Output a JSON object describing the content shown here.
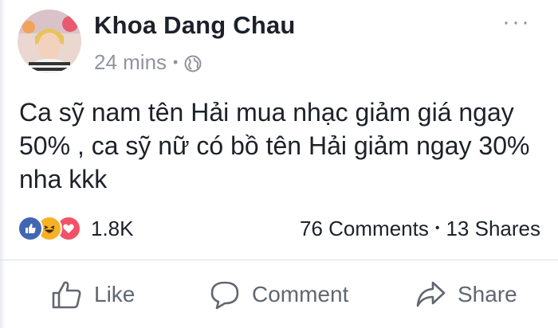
{
  "post": {
    "author": "Khoa Dang Chau",
    "time": "24 mins",
    "separator": "•",
    "privacy_icon": "globe-icon",
    "more_icon": "ellipsis-icon",
    "more_label": "···",
    "text": "Ca sỹ nam tên Hải mua nhạc giảm giá ngay 50% , ca sỹ nữ có bồ tên Hải giảm ngay 30% nha kkk"
  },
  "engagement": {
    "reaction_icons": [
      "like-reaction-icon",
      "haha-reaction-icon",
      "love-reaction-icon"
    ],
    "reaction_count": "1.8K",
    "comments": "76 Comments",
    "separator": "•",
    "shares": "13 Shares"
  },
  "actions": {
    "like": "Like",
    "comment": "Comment",
    "share": "Share"
  },
  "colors": {
    "like_blue": "#4267b2",
    "haha_yellow": "#f7b125",
    "love_red": "#f25268",
    "secondary_text": "#90949c",
    "action_text": "#606770"
  }
}
